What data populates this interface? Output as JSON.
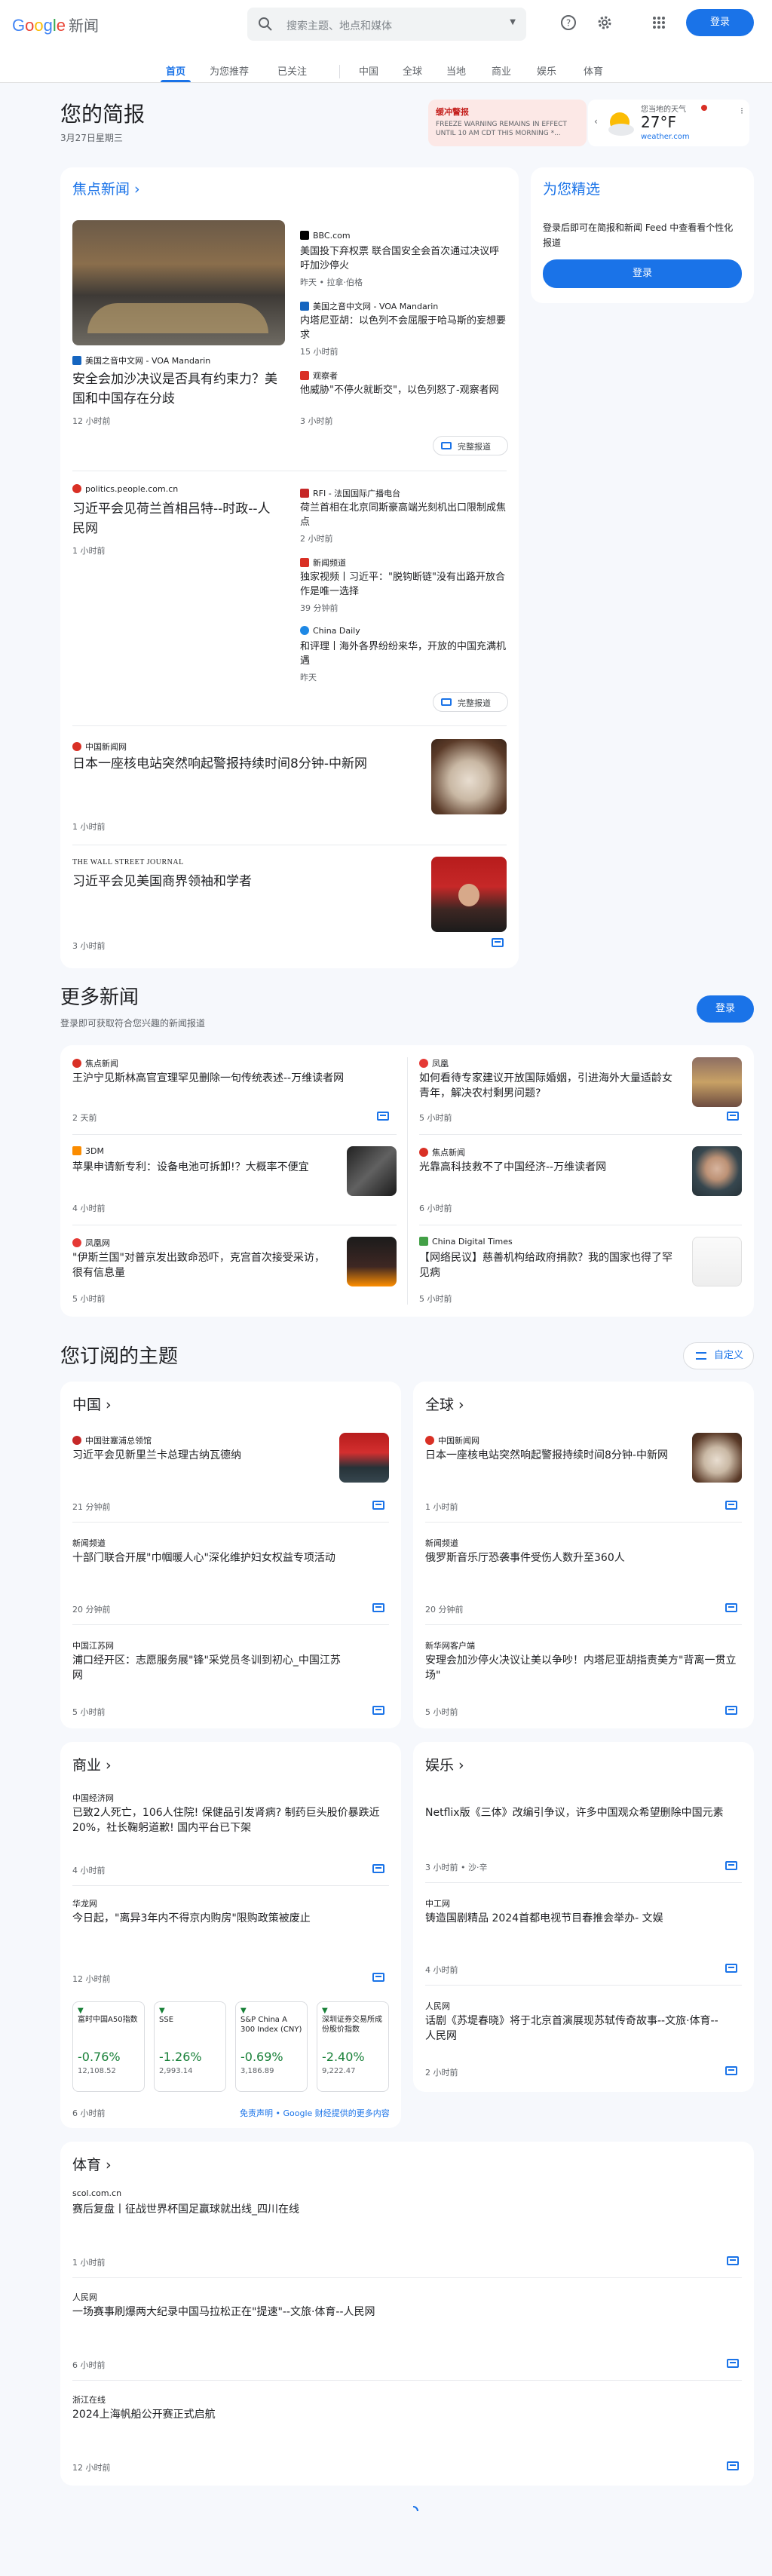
{
  "header": {
    "logo_google": [
      "G",
      "o",
      "o",
      "g",
      "l",
      "e"
    ],
    "logo_suffix": "新闻",
    "search_placeholder": "搜索主题、地点和媒体",
    "login": "登录"
  },
  "nav": {
    "tabs": [
      "首页",
      "为您推荐",
      "已关注",
      "中国",
      "全球",
      "当地",
      "商业",
      "娱乐",
      "体育"
    ],
    "active": "首页"
  },
  "briefing": {
    "title": "您的简报",
    "date": "3月27日星期三",
    "alert_title": "缓冲警报",
    "alert_body": "FREEZE WARNING REMAINS IN EFFECT UNTIL 10 AM CDT THIS MORNING *...",
    "weather_label": "您当地的天气",
    "weather_temp": "27°F",
    "weather_source": "weather.com"
  },
  "top_stories": {
    "title": "焦点新闻",
    "story1": {
      "source": "美国之音中文网 - VOA Mandarin",
      "headline": "安全会加沙决议是否具有约束力？美国和中国存在分歧",
      "time": "12 小时前",
      "side": [
        {
          "source": "BBC.com",
          "headline": "美国投下弃权票 联合国安全会首次通过决议呼吁加沙停火",
          "time": "昨天 • 拉拿·伯格"
        },
        {
          "source": "美国之音中文网 - VOA Mandarin",
          "headline": "内塔尼亚胡：以色列不会屈服于哈马斯的妄想要求",
          "time": "15 小时前"
        },
        {
          "source": "观察者",
          "headline": "他威胁\"不停火就断交\"，以色列怒了-观察者网",
          "time": "3 小时前"
        }
      ],
      "full": "完整报道"
    },
    "story2": {
      "source": "politics.people.com.cn",
      "headline": "习近平会见荷兰首相吕特--时政--人民网",
      "time": "1 小时前",
      "side": [
        {
          "source": "RFI - 法国国际广播电台",
          "headline": "荷兰首相在北京同斯豪高端光刻机出口限制成焦点",
          "time": "2 小时前"
        },
        {
          "source": "新闻频道",
          "headline": "独家视频丨习近平：\"脱钩断链\"没有出路开放合作是唯一选择",
          "time": "39 分钟前"
        },
        {
          "source": "China Daily",
          "headline": "和评理丨海外各界纷纷来华，开放的中国充满机遇",
          "time": "昨天"
        }
      ],
      "full": "完整报道"
    },
    "story3": {
      "source": "中国新闻网",
      "headline": "日本一座核电站突然响起警报持续时间8分钟-中新网",
      "time": "1 小时前"
    },
    "story4": {
      "source": "THE WALL STREET JOURNAL",
      "headline": "习近平会见美国商界领袖和学者",
      "time": "3 小时前"
    }
  },
  "picks": {
    "title": "为您精选",
    "text": "登录后即可在简报和新闻 Feed 中查看看个性化报道",
    "button": "登录"
  },
  "more_news": {
    "title": "更多新闻",
    "subtitle": "登录即可获取符合您兴趣的新闻报道",
    "login": "登录",
    "items": [
      {
        "source": "焦点新闻",
        "headline": "王沪宁见斯林高官宣理罕见删除一句传统表述--万维读者网",
        "time": "2 天前"
      },
      {
        "source": "凤凰",
        "headline": "如何看待专家建议开放国际婚姻，引进海外大量适龄女青年，解决农村剩男问题?",
        "time": "5 小时前"
      },
      {
        "source": "3DM",
        "headline": "苹果申请新专利：设备电池可拆卸!？大概率不便宜",
        "time": "4 小时前"
      },
      {
        "source": "焦点新闻",
        "headline": "光靠高科技救不了中国经济--万维读者网",
        "time": "6 小时前"
      },
      {
        "source": "凤凰网",
        "headline": "\"伊斯兰国\"对普京发出致命恐吓，克宫首次接受采访，很有信息量",
        "time": "5 小时前"
      },
      {
        "source": "China Digital Times",
        "headline": "【网络民议】慈善机构给政府捐款？我的国家也得了罕见病",
        "time": "5 小时前"
      }
    ]
  },
  "topics": {
    "title": "您订阅的主题",
    "customize": "自定义",
    "china": {
      "title": "中国",
      "items": [
        {
          "source": "中国驻塞浦总领馆",
          "headline": "习近平会见新里兰卡总理古纳瓦德纳",
          "time": "21 分钟前"
        },
        {
          "source": "新闻频道",
          "headline": "十部门联合开展\"巾帼暖人心\"深化维护妇女权益专项活动",
          "time": "20 分钟前"
        },
        {
          "source": "中国江苏网",
          "headline": "浦口经开区：志愿服务展\"锋\"采党员冬训到初心_中国江苏网",
          "time": "5 小时前"
        }
      ]
    },
    "world": {
      "title": "全球",
      "items": [
        {
          "source": "中国新闻网",
          "headline": "日本一座核电站突然响起警报持续时间8分钟-中新网",
          "time": "1 小时前"
        },
        {
          "source": "新闻频道",
          "headline": "俄罗斯音乐厅恐袭事件受伤人数升至360人",
          "time": "20 分钟前"
        },
        {
          "source": "新华网客户端",
          "headline": "安理会加沙停火决议让美以争吵！内塔尼亚胡指责美方\"背离一贯立场\"",
          "time": "5 小时前"
        }
      ]
    },
    "business": {
      "title": "商业",
      "items": [
        {
          "source": "中国经济网",
          "headline": "已致2人死亡，106人住院! 保健品引发肾病? 制药巨头股价暴跌近20%，社长鞠躬道歉! 国内平台已下架",
          "time": "4 小时前"
        },
        {
          "source": "华龙网",
          "headline": "今日起，\"离异3年内不得京内购房\"限购政策被废止",
          "time": "12 小时前"
        }
      ],
      "stocks": [
        {
          "name": "富时中国A50指数",
          "pct": "-0.76%",
          "value": "12,108.52"
        },
        {
          "name": "SSE",
          "pct": "-1.26%",
          "value": "2,993.14"
        },
        {
          "name": "S&P China A 300 Index (CNY)",
          "pct": "-0.69%",
          "value": "3,186.89"
        },
        {
          "name": "深圳证券交易所成份股价指数",
          "pct": "-2.40%",
          "value": "9,222.47"
        }
      ],
      "footer_time": "6 小时前",
      "disclaimer": "免责声明 • Google 财经提供的更多内容"
    },
    "entertainment": {
      "title": "娱乐",
      "items": [
        {
          "source": "",
          "headline": "Netflix版《三体》改编引争议，许多中国观众希望删除中国元素",
          "time": "3 小时前 • 沙·辛"
        },
        {
          "source": "中工网",
          "headline": "铸造国剧精品 2024首都电视节目春推会举办- 文娱",
          "time": "4 小时前"
        },
        {
          "source": "人民网",
          "headline": "话剧《苏堤春晓》将于北京首演展现苏轼传奇故事--文旅·体育--人民网",
          "time": "2 小时前"
        }
      ]
    },
    "sports": {
      "title": "体育",
      "items": [
        {
          "source": "scol.com.cn",
          "headline": "赛后复盘丨征战世界杯国足赢球就出线_四川在线",
          "time": "1 小时前"
        },
        {
          "source": "人民网",
          "headline": "一场赛事刷爆两大纪录中国马拉松正在\"提速\"--文旅·体育--人民网",
          "time": "6 小时前"
        },
        {
          "source": "浙江在线",
          "headline": "2024上海帆船公开赛正式启航",
          "time": "12 小时前"
        }
      ]
    }
  },
  "colors": {
    "accent": "#1a73e8",
    "alert": "#c5221f",
    "up": "#188038"
  }
}
